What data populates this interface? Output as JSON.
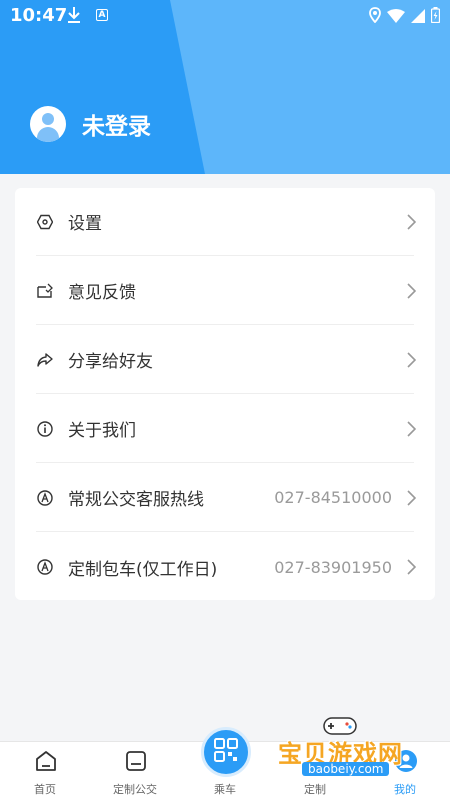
{
  "status_bar": {
    "time": "10:47",
    "app_badge": "A"
  },
  "profile": {
    "name": "未登录"
  },
  "menu": {
    "items": [
      {
        "label": "设置",
        "phone": "",
        "icon": "gear-icon"
      },
      {
        "label": "意见反馈",
        "phone": "",
        "icon": "feedback-icon"
      },
      {
        "label": "分享给好友",
        "phone": "",
        "icon": "share-icon"
      },
      {
        "label": "关于我们",
        "phone": "",
        "icon": "info-icon"
      },
      {
        "label": "常规公交客服热线",
        "phone": "027-84510000",
        "icon": "hotline-icon"
      },
      {
        "label": "定制包车(仅工作日)",
        "phone": "027-83901950",
        "icon": "hotline-icon"
      }
    ]
  },
  "tabbar": {
    "tabs": [
      {
        "label": "首页"
      },
      {
        "label": "定制公交"
      },
      {
        "label": "乘车"
      },
      {
        "label": "定制"
      },
      {
        "label": "我的"
      }
    ]
  },
  "watermark": {
    "text": "宝贝游戏网",
    "url": "baobeiy.com"
  },
  "colors": {
    "primary": "#2b9cf6",
    "primary_light": "#5db6fa",
    "text": "#333333",
    "muted": "#9a9a9a"
  }
}
